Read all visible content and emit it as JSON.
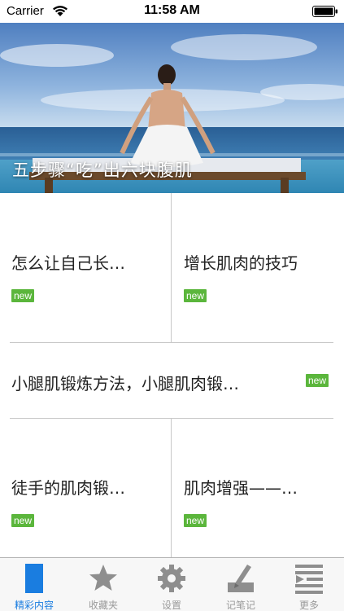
{
  "status_bar": {
    "carrier": "Carrier",
    "time": "11:58 AM"
  },
  "hero": {
    "caption": "五步骤“吃”出六块腹肌"
  },
  "articles": [
    {
      "title": "怎么让自己长…",
      "badge": "new"
    },
    {
      "title": "增长肌肉的技巧",
      "badge": "new"
    },
    {
      "title": "小腿肌锻炼方法，小腿肌肉锻…",
      "badge": "new"
    },
    {
      "title": "徒手的肌肉锻…",
      "badge": "new"
    },
    {
      "title": "肌肉增强——…",
      "badge": "new"
    }
  ],
  "tabbar": {
    "items": [
      {
        "label": "精彩内容",
        "icon": "document-icon",
        "active": true
      },
      {
        "label": "收藏夹",
        "icon": "star-icon",
        "active": false
      },
      {
        "label": "设置",
        "icon": "gear-icon",
        "active": false
      },
      {
        "label": "记笔记",
        "icon": "pen-note-icon",
        "active": false
      },
      {
        "label": "更多",
        "icon": "more-list-icon",
        "active": false
      }
    ]
  },
  "colors": {
    "accent": "#1a7de0",
    "badge": "#5bb63c",
    "divider": "#c8c8c8",
    "tab_inactive": "#9a9a9a"
  }
}
